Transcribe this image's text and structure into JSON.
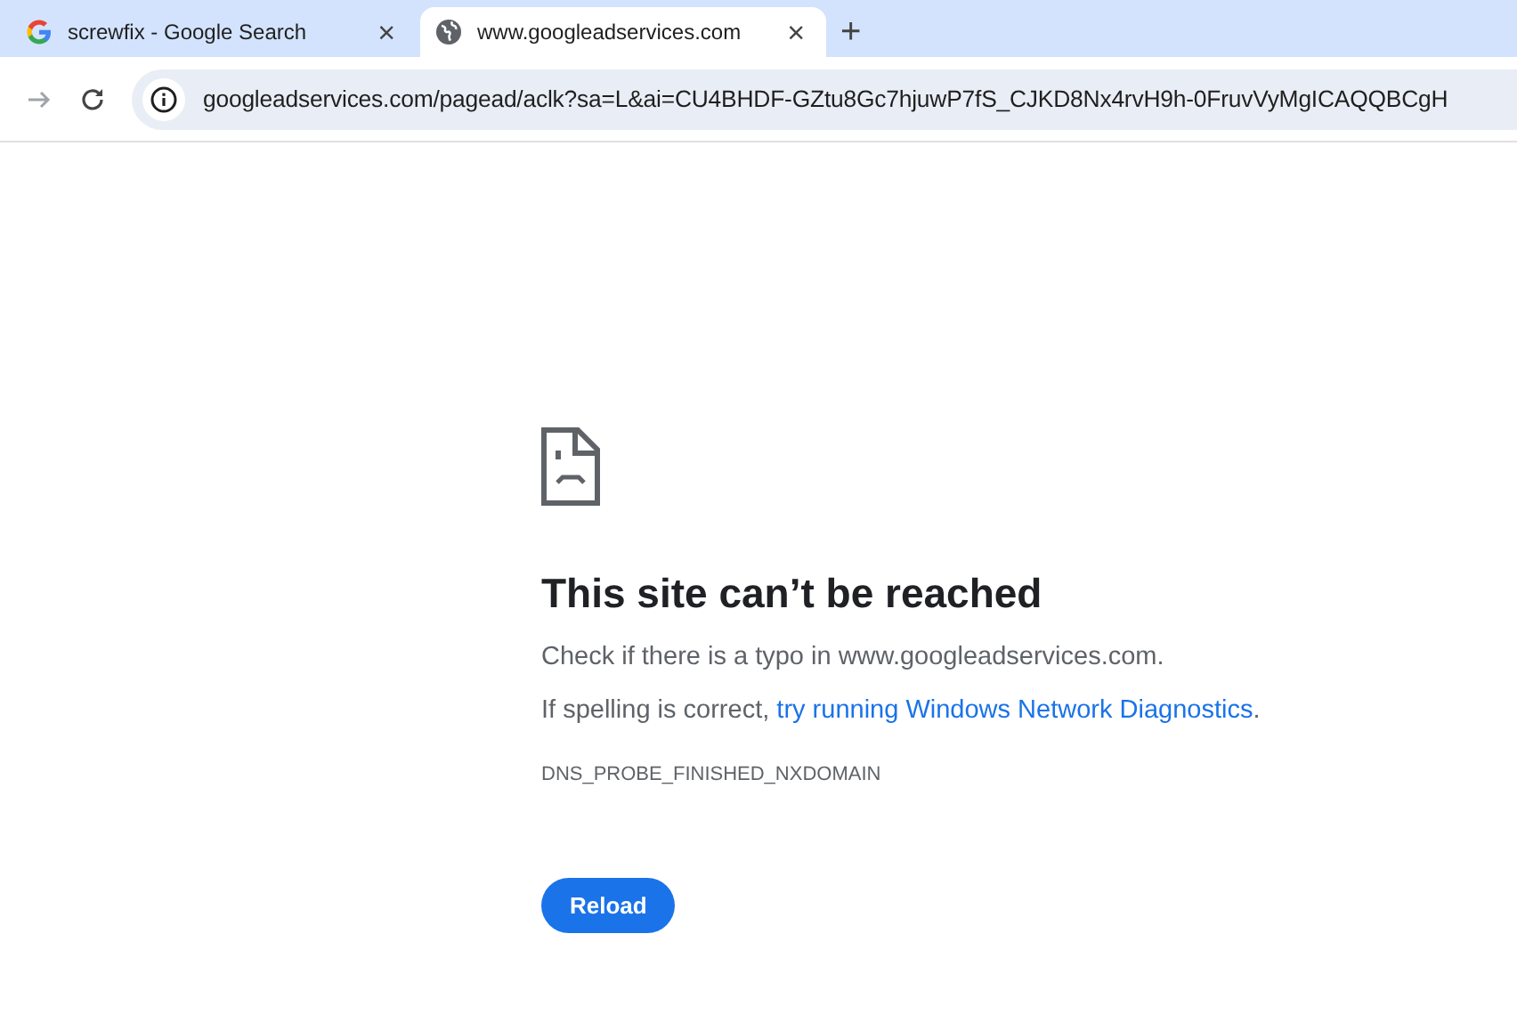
{
  "tabs": [
    {
      "title": "screwfix - Google Search",
      "kind": "search",
      "close": "×",
      "selected": false
    },
    {
      "title": "www.googleadservices.com",
      "kind": "site",
      "close": "×",
      "selected": true
    }
  ],
  "new_tab": "+",
  "toolbar": {
    "forward_disabled": true,
    "url": "googleadservices.com/pagead/aclk?sa=L&ai=CU4BHDF-GZtu8Gc7hjuwP7fS_CJKD8Nx4rvH9h-0FruvVyMgICAQQBCgH"
  },
  "error": {
    "title": "This site can’t be reached",
    "hint": "Check if there is a typo in www.googleadservices.com.",
    "suggestion_prefix": "If spelling is correct,",
    "suggestion_link": "try running Windows Network Diagnostics",
    "suggestion_suffix": ".",
    "code": "DNS_PROBE_FINISHED_NXDOMAIN",
    "button": "Reload"
  }
}
